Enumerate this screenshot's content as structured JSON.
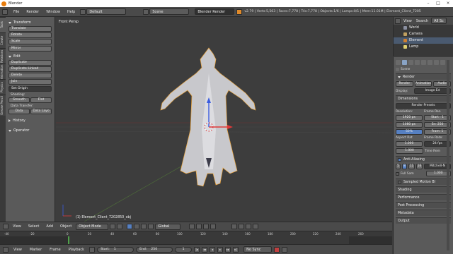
{
  "window": {
    "title": "Blender"
  },
  "info_header": {
    "menus": [
      "File",
      "Render",
      "Window",
      "Help"
    ],
    "screen_layout": "Default",
    "scene": "Scene",
    "render_engine": "Blender Render",
    "stats": "v2.79 | Verts:5,563 | Faces:7,778 | Tris:7,778 | Objects:1/6 | Lamps:0/1 | Mem:11.01M | Element_Client_7205"
  },
  "toolshelf": {
    "tabs": [
      "Tools",
      "Create",
      "Relations",
      "Animation",
      "Physics",
      "Grease Pencil"
    ],
    "transform": {
      "header": "Transform",
      "buttons": [
        "Translate",
        "Rotate",
        "Scale",
        "Mirror"
      ]
    },
    "edit": {
      "header": "Edit",
      "buttons": [
        "Duplicate",
        "Duplicate Linked",
        "Delete",
        "Join"
      ],
      "set_origin": "Set Origin"
    },
    "shading": {
      "label": "Shading:",
      "smooth": "Smooth",
      "flat": "Flat"
    },
    "data_transfer": {
      "label": "Data Transfer:",
      "data": "Data",
      "data_layout": "Data Layo"
    },
    "history": "History",
    "operator": "Operator"
  },
  "viewport": {
    "view_label": "Front Persp",
    "object_label": "(1) Element_Client_7202850_obj"
  },
  "viewport_header": {
    "menus": [
      "View",
      "Select",
      "Add",
      "Object"
    ],
    "mode": "Object Mode",
    "orientation": "Global"
  },
  "timeline": {
    "ticks": [
      "-40",
      "-20",
      "0",
      "20",
      "40",
      "60",
      "80",
      "100",
      "120",
      "140",
      "160",
      "180",
      "200",
      "220",
      "240",
      "260"
    ],
    "menus": [
      "View",
      "Marker",
      "Frame",
      "Playback"
    ],
    "start_label": "Start:",
    "start_value": "1",
    "end_label": "End:",
    "end_value": "250",
    "current_frame": "1",
    "sync": "No Sync"
  },
  "outliner": {
    "header_menus": [
      "View",
      "Search",
      "All Sc"
    ],
    "items": [
      "World",
      "Camera",
      "Element",
      "Lamp"
    ]
  },
  "properties": {
    "breadcrumb": "Scene",
    "render": {
      "header": "Render",
      "buttons": [
        "Render",
        "Animation",
        "Audio"
      ],
      "display_label": "Display:",
      "display_value": "Image Ed"
    },
    "dimensions": {
      "header": "Dimensions",
      "presets": "Render Presets",
      "resolution_label": "Resolution:",
      "res_x": "1920 px",
      "res_y": "1080 px",
      "res_pct": "50%",
      "frame_range_label": "Frame Ran",
      "start": "Start : 1",
      "end": "En: 250",
      "step": "Fram: 1",
      "aspect_label": "Aspect Rat",
      "aspect_x": "1.000",
      "aspect_y": "1.000",
      "frame_rate_label": "Frame Rate:",
      "fps": "24 fps",
      "time_rem": "Time Rem"
    },
    "anti_aliasing": {
      "header": "Anti-Aliasing",
      "samples": [
        "5",
        "8",
        "11",
        "16"
      ],
      "filter": "Mitchell-N",
      "full_sample": "Full Sam",
      "size": "1.000"
    },
    "sampled_motion_blur": "Sampled Motion Bl",
    "shading": "Shading",
    "performance": "Performance",
    "post_processing": "Post Processing",
    "metadata": "Metadata",
    "output": "Output"
  },
  "colors": {
    "selection_orange": "#e8a23c",
    "axis_red": "#a83a3a",
    "axis_green": "#6c9a3c",
    "axis_blue": "#3a5ca8",
    "active_blue": "#5680c2"
  }
}
